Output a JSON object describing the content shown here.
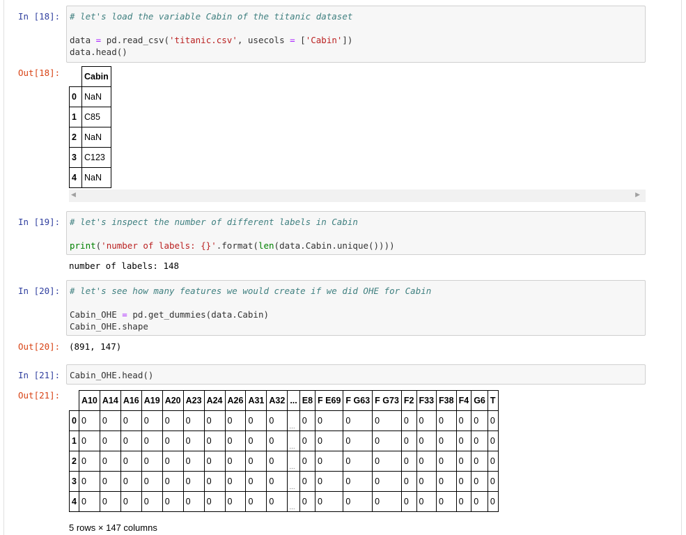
{
  "cells": {
    "c18": {
      "in_prompt": "In [18]:",
      "code": {
        "comment": "# let's load the variable Cabin of the titanic dataset",
        "line2": [
          "data ",
          "=",
          " pd.read_csv(",
          "'titanic.csv'",
          ", usecols ",
          "=",
          " [",
          "'Cabin'",
          "])"
        ],
        "line3": "data.head()"
      },
      "out_prompt": "Out[18]:",
      "table": {
        "header": "Cabin",
        "index": [
          "0",
          "1",
          "2",
          "3",
          "4"
        ],
        "values": [
          "NaN",
          "C85",
          "NaN",
          "C123",
          "NaN"
        ]
      }
    },
    "c19": {
      "in_prompt": "In [19]:",
      "code": {
        "comment": "# let's inspect the number of different labels in Cabin",
        "line2": [
          "print",
          "(",
          "'number of labels: {}'",
          ".format(",
          "len",
          "(data.Cabin.unique())))"
        ]
      },
      "stream": "number of labels: 148"
    },
    "c20": {
      "in_prompt": "In [20]:",
      "code": {
        "comment": "# let's see how many features we would create if we did OHE for Cabin",
        "line2": [
          "Cabin_OHE ",
          "=",
          " pd.get_dummies(data.Cabin)"
        ],
        "line3": "Cabin_OHE.shape"
      },
      "out_prompt": "Out[20]:",
      "output": "(891, 147)"
    },
    "c21": {
      "in_prompt": "In [21]:",
      "code": {
        "line1": "Cabin_OHE.head()"
      },
      "out_prompt": "Out[21]:",
      "table": {
        "columns": [
          "A10",
          "A14",
          "A16",
          "A19",
          "A20",
          "A23",
          "A24",
          "A26",
          "A31",
          "A32",
          "...",
          "E8",
          "F E69",
          "F G63",
          "F G73",
          "F2",
          "F33",
          "F38",
          "F4",
          "G6",
          "T"
        ],
        "index": [
          "0",
          "1",
          "2",
          "3",
          "4"
        ],
        "rows": [
          [
            "0",
            "0",
            "0",
            "0",
            "0",
            "0",
            "0",
            "0",
            "0",
            "0",
            "...",
            "0",
            "0",
            "0",
            "0",
            "0",
            "0",
            "0",
            "0",
            "0",
            "0"
          ],
          [
            "0",
            "0",
            "0",
            "0",
            "0",
            "0",
            "0",
            "0",
            "0",
            "0",
            "...",
            "0",
            "0",
            "0",
            "0",
            "0",
            "0",
            "0",
            "0",
            "0",
            "0"
          ],
          [
            "0",
            "0",
            "0",
            "0",
            "0",
            "0",
            "0",
            "0",
            "0",
            "0",
            "...",
            "0",
            "0",
            "0",
            "0",
            "0",
            "0",
            "0",
            "0",
            "0",
            "0"
          ],
          [
            "0",
            "0",
            "0",
            "0",
            "0",
            "0",
            "0",
            "0",
            "0",
            "0",
            "...",
            "0",
            "0",
            "0",
            "0",
            "0",
            "0",
            "0",
            "0",
            "0",
            "0"
          ],
          [
            "0",
            "0",
            "0",
            "0",
            "0",
            "0",
            "0",
            "0",
            "0",
            "0",
            "...",
            "0",
            "0",
            "0",
            "0",
            "0",
            "0",
            "0",
            "0",
            "0",
            "0"
          ]
        ],
        "shape_text": "5 rows × 147 columns"
      }
    }
  },
  "colors": {
    "in_prompt": "#303f9f",
    "out_prompt": "#d84315",
    "comment": "#408080",
    "string": "#ba2121",
    "builtin": "#008000",
    "operator": "#aa22ff"
  }
}
